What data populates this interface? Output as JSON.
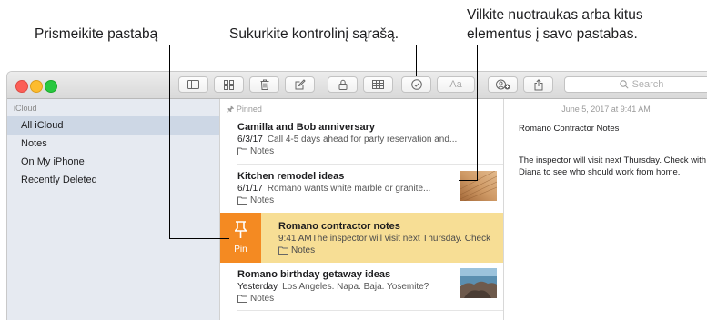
{
  "callouts": {
    "pin_note": "Prismeikite pastabą",
    "checklist": "Sukurkite kontrolinį sąrašą.",
    "drag_line1": "Vilkite nuotraukas arba kitus",
    "drag_line2": "elementus į savo pastabas."
  },
  "toolbar": {
    "format_label": "Aa",
    "search_placeholder": "Search",
    "icons": [
      "sidebar-toggle-icon",
      "gallery-icon",
      "trash-icon",
      "compose-icon",
      "lock-icon",
      "table-icon",
      "checklist-icon",
      "format-icon",
      "add-people-icon",
      "share-icon",
      "search-icon"
    ]
  },
  "sidebar": {
    "section": "iCloud",
    "items": [
      {
        "label": "All iCloud",
        "selected": true
      },
      {
        "label": "Notes",
        "selected": false
      },
      {
        "label": "On My iPhone",
        "selected": false
      },
      {
        "label": "Recently Deleted",
        "selected": false
      }
    ]
  },
  "notes": {
    "pinned_header": "Pinned",
    "items": [
      {
        "title": "Camilla and Bob anniversary",
        "date": "6/3/17",
        "preview": "Call 4-5 days ahead for party reservation and...",
        "folder": "Notes"
      },
      {
        "title": "Kitchen remodel ideas",
        "date": "6/1/17",
        "preview": "Romano wants white marble or granite...",
        "folder": "Notes"
      },
      {
        "title": "Romano contractor notes",
        "date": "9:41 AM",
        "preview": "The inspector will visit next Thursday. Check",
        "folder": "Notes"
      },
      {
        "title": "Romano birthday getaway ideas",
        "date": "Yesterday",
        "preview": "Los Angeles. Napa. Baja. Yosemite?",
        "folder": "Notes"
      }
    ],
    "pin_action": "Pin"
  },
  "editor": {
    "date": "June 5, 2017 at 9:41 AM",
    "title": "Romano Contractor Notes",
    "body": "The inspector will visit next Thursday. Check with Diana to see who should work from home."
  },
  "colors": {
    "pin_accent": "#f48a22",
    "highlight_row": "#f7de95",
    "sidebar_bg": "#e6eaf1",
    "sidebar_selected": "#cdd7e5"
  }
}
